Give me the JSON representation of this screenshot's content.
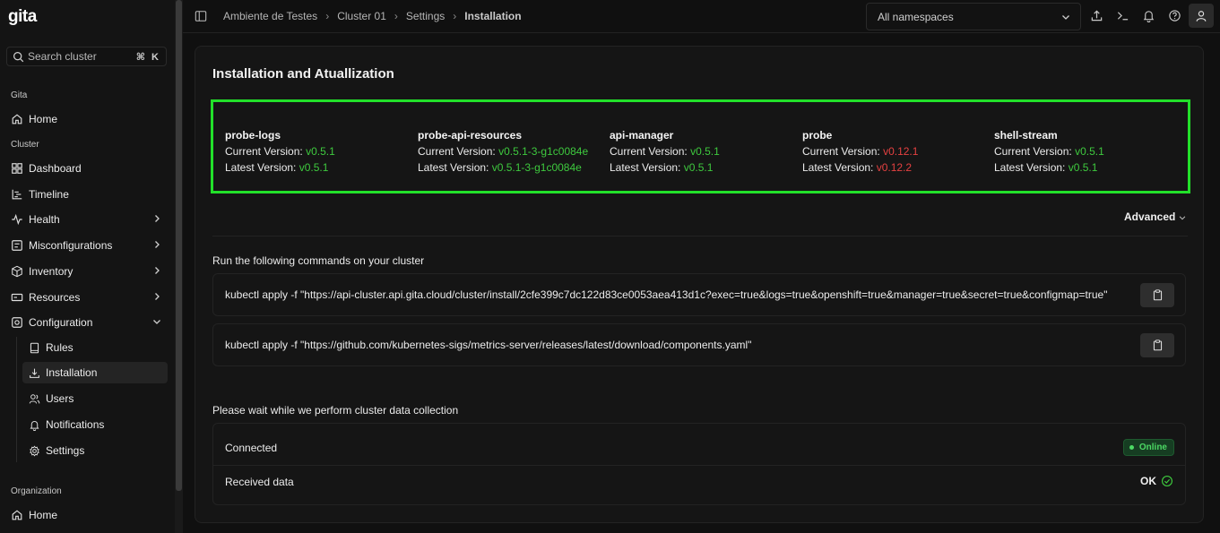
{
  "app": {
    "logo": "gita"
  },
  "sidebar": {
    "search_placeholder": "Search cluster",
    "search_shortcut": "⌘ K",
    "sections": {
      "gita": "Gita",
      "cluster": "Cluster",
      "organization": "Organization"
    },
    "gita_items": [
      {
        "label": "Home",
        "icon": "home-icon"
      }
    ],
    "cluster_items": [
      {
        "label": "Dashboard",
        "icon": "dashboard-icon"
      },
      {
        "label": "Timeline",
        "icon": "timeline-icon"
      },
      {
        "label": "Health",
        "icon": "health-icon"
      },
      {
        "label": "Misconfigurations",
        "icon": "misconfig-icon"
      },
      {
        "label": "Inventory",
        "icon": "inventory-icon"
      },
      {
        "label": "Resources",
        "icon": "resources-icon"
      },
      {
        "label": "Configuration",
        "icon": "configuration-icon"
      }
    ],
    "configuration_items": [
      {
        "label": "Rules",
        "icon": "book-icon"
      },
      {
        "label": "Installation",
        "icon": "download-icon"
      },
      {
        "label": "Users",
        "icon": "users-icon"
      },
      {
        "label": "Notifications",
        "icon": "bell-icon"
      },
      {
        "label": "Settings",
        "icon": "gear-icon"
      }
    ],
    "organization_items": [
      {
        "label": "Home",
        "icon": "home-icon"
      }
    ]
  },
  "header": {
    "breadcrumb": [
      "Ambiente de Testes",
      "Cluster 01",
      "Settings",
      "Installation"
    ],
    "namespace": "All namespaces"
  },
  "main": {
    "title": "Installation and Atuallization",
    "current_label": "Current Version:",
    "latest_label": "Latest Version:",
    "components": [
      {
        "name": "probe-logs",
        "current": "v0.5.1",
        "latest": "v0.5.1",
        "current_status": "ok"
      },
      {
        "name": "probe-api-resources",
        "current": "v0.5.1-3-g1c0084e",
        "latest": "v0.5.1-3-g1c0084e",
        "current_status": "ok"
      },
      {
        "name": "api-manager",
        "current": "v0.5.1",
        "latest": "v0.5.1",
        "current_status": "ok"
      },
      {
        "name": "probe",
        "current": "v0.12.1",
        "latest": "v0.12.2",
        "current_status": "outdated"
      },
      {
        "name": "shell-stream",
        "current": "v0.5.1",
        "latest": "v0.5.1",
        "current_status": "ok"
      }
    ],
    "advanced_label": "Advanced",
    "commands_label": "Run the following commands on your cluster",
    "commands": [
      "kubectl apply -f \"https://api-cluster.api.gita.cloud/cluster/install/2cfe399c7dc122d83ce0053aea413d1c?exec=true&logs=true&openshift=true&manager=true&secret=true&configmap=true\"",
      "kubectl apply -f \"https://github.com/kubernetes-sigs/metrics-server/releases/latest/download/components.yaml\""
    ],
    "wait_label": "Please wait while we perform cluster data collection",
    "status": {
      "connected_label": "Connected",
      "connected_value": "Online",
      "received_label": "Received data",
      "received_value": "OK"
    }
  },
  "colors": {
    "accent_green": "#22e02a",
    "ok_green": "#3ec93e",
    "outdated_red": "#e54141"
  }
}
